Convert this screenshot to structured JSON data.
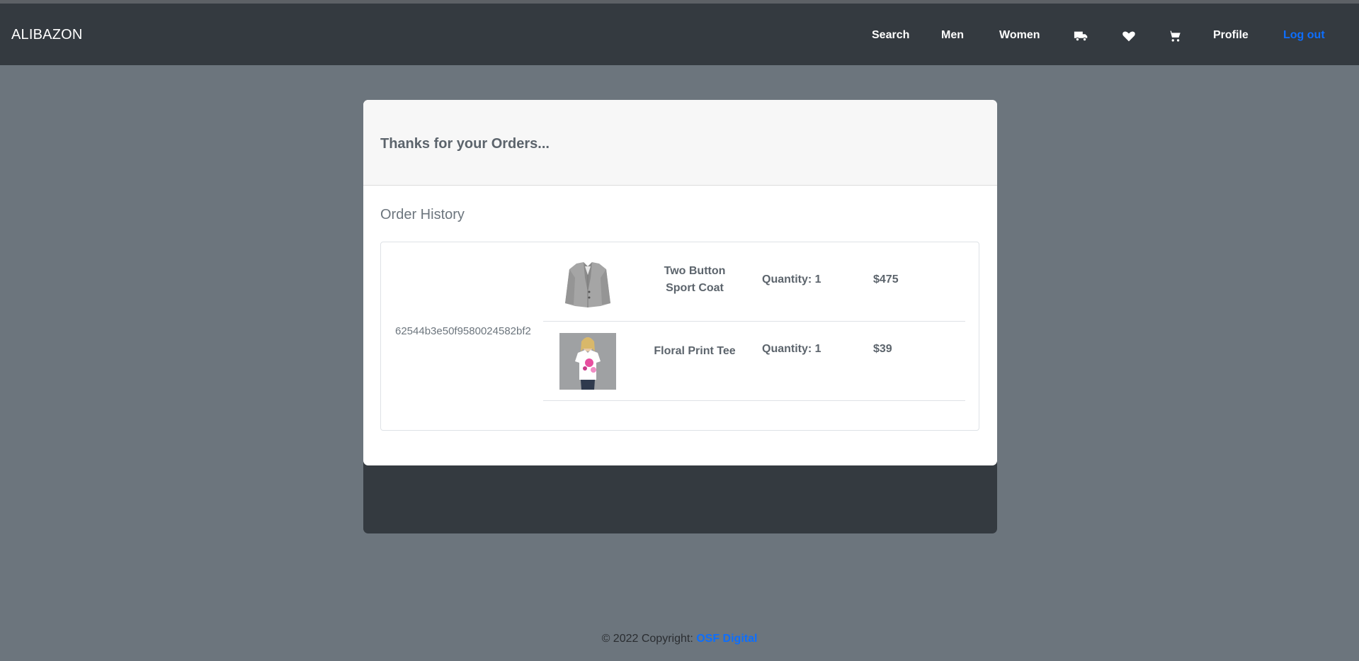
{
  "navbar": {
    "brand": "ALIBAZON",
    "links": {
      "search": "Search",
      "men": "Men",
      "women": "Women",
      "profile": "Profile",
      "logout": "Log out"
    },
    "icons": [
      "truck-icon",
      "heart-icon",
      "cart-icon"
    ],
    "colors": {
      "background": "#343a40",
      "logout": "#0d6efd"
    }
  },
  "card": {
    "header": "Thanks for your Orders...",
    "section_title": "Order History"
  },
  "order": {
    "id": "62544b3e50f9580024582bf2",
    "items": [
      {
        "name": "Two Button Sport Coat",
        "quantity": "Quantity: 1",
        "price": "$475",
        "image": "gray-sport-coat"
      },
      {
        "name": "Floral Print Tee",
        "quantity": "Quantity: 1",
        "price": "$39",
        "image": "floral-print-tee"
      }
    ]
  },
  "footer": {
    "text": "© 2022 Copyright: ",
    "link": "OSF Digital"
  },
  "colors": {
    "page_background": "#6c757d",
    "accent": "#0d6efd"
  }
}
